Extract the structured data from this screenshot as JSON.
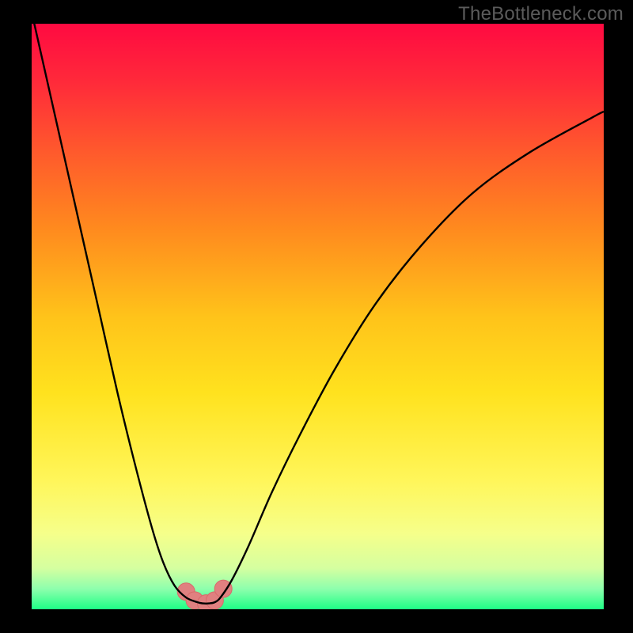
{
  "watermark": "TheBottleneck.com",
  "colors": {
    "black": "#000000",
    "curve": "#000000",
    "marker_fill": "#e08080",
    "marker_stroke": "#d86a6a"
  },
  "chart_data": {
    "type": "line",
    "title": "",
    "xlabel": "",
    "ylabel": "",
    "xlim": [
      0,
      100
    ],
    "ylim": [
      0,
      100
    ],
    "grid": false,
    "background_gradient": {
      "direction": "vertical",
      "stops": [
        {
          "pos": 0.0,
          "color": "#ff0a41"
        },
        {
          "pos": 0.1,
          "color": "#ff2a3a"
        },
        {
          "pos": 0.22,
          "color": "#ff5a2c"
        },
        {
          "pos": 0.35,
          "color": "#ff8a1e"
        },
        {
          "pos": 0.5,
          "color": "#ffc31a"
        },
        {
          "pos": 0.63,
          "color": "#ffe21e"
        },
        {
          "pos": 0.78,
          "color": "#fff65a"
        },
        {
          "pos": 0.87,
          "color": "#f6ff8a"
        },
        {
          "pos": 0.93,
          "color": "#d5ffa0"
        },
        {
          "pos": 0.965,
          "color": "#8effad"
        },
        {
          "pos": 1.0,
          "color": "#1eff86"
        }
      ]
    },
    "series": [
      {
        "name": "bottleneck-curve",
        "x": [
          0,
          3,
          6,
          9,
          12,
          15,
          18,
          21,
          23,
          25,
          27,
          29,
          30,
          31,
          32,
          33,
          35,
          38,
          42,
          47,
          53,
          60,
          68,
          77,
          87,
          98,
          100
        ],
        "values": [
          102,
          89,
          76,
          63,
          50,
          37,
          25,
          14,
          8,
          4,
          2,
          1.2,
          1,
          1,
          1.2,
          2,
          5,
          11,
          20,
          30,
          41,
          52,
          62,
          71,
          78,
          84,
          85
        ]
      }
    ],
    "markers": [
      {
        "x": 27.0,
        "y": 3.0
      },
      {
        "x": 28.5,
        "y": 1.5
      },
      {
        "x": 30.5,
        "y": 1.0
      },
      {
        "x": 32.0,
        "y": 1.5
      },
      {
        "x": 33.5,
        "y": 3.5
      }
    ],
    "marker_radius_px": 11
  }
}
